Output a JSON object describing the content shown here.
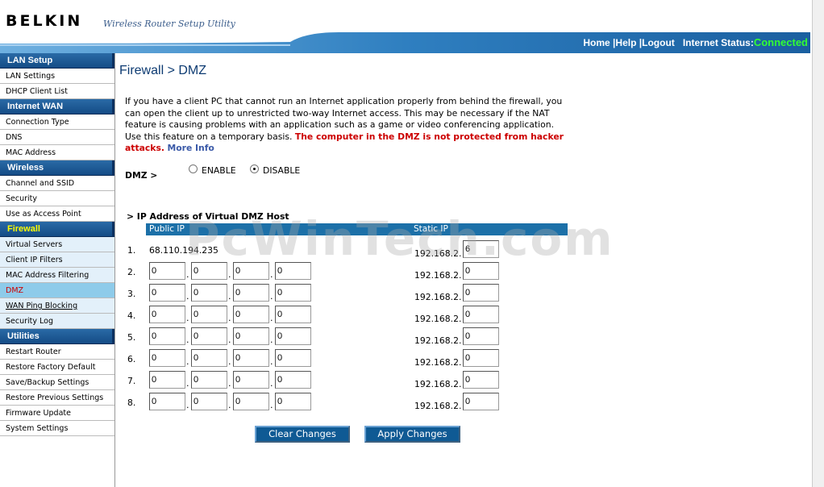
{
  "header": {
    "brand": "BELKIN",
    "tagline": "Wireless Router Setup Utility",
    "home": "Home",
    "help": "Help",
    "logout": "Logout",
    "status_label": "Internet Status:",
    "status_value": "Connected",
    "status_color": "#33ff33"
  },
  "sidebar": {
    "sections": [
      {
        "title": "LAN Setup",
        "items": [
          "LAN Settings",
          "DHCP Client List"
        ]
      },
      {
        "title": "Internet WAN",
        "items": [
          "Connection Type",
          "DNS",
          "MAC Address"
        ]
      },
      {
        "title": "Wireless",
        "items": [
          "Channel and SSID",
          "Security",
          "Use as Access Point"
        ]
      },
      {
        "title": "Firewall",
        "items": [
          "Virtual Servers",
          "Client IP Filters",
          "MAC Address Filtering",
          "DMZ",
          "WAN Ping Blocking",
          "Security Log"
        ]
      },
      {
        "title": "Utilities",
        "items": [
          "Restart Router",
          "Restore Factory Default",
          "Save/Backup Settings",
          "Restore Previous Settings",
          "Firmware Update",
          "System Settings"
        ]
      }
    ]
  },
  "main": {
    "title": "Firewall > DMZ",
    "description": "If you have a client PC that cannot run an Internet application properly from behind the firewall, you can open the client up to unrestricted two-way Internet access. This may be necessary if the NAT feature is causing problems with an application such as a game or video conferencing application. Use this feature on a temporary basis.",
    "warning": "The computer in the DMZ is not protected from hacker attacks.",
    "more_info": "More Info",
    "dmz_label": "DMZ >",
    "enable_label": "ENABLE",
    "disable_label": "DISABLE",
    "selected": "DISABLE",
    "subheading": "> IP Address of Virtual DMZ Host",
    "col_public": "Public IP",
    "col_static": "Static IP",
    "row1": {
      "num": "1.",
      "public_ip": "68.110.194.235",
      "static_prefix": "192.168.2.",
      "static_last": "6"
    },
    "rows": [
      {
        "num": "2.",
        "octets": [
          "0",
          "0",
          "0",
          "0"
        ],
        "static_prefix": "192.168.2.",
        "static_last": "0"
      },
      {
        "num": "3.",
        "octets": [
          "0",
          "0",
          "0",
          "0"
        ],
        "static_prefix": "192.168.2.",
        "static_last": "0"
      },
      {
        "num": "4.",
        "octets": [
          "0",
          "0",
          "0",
          "0"
        ],
        "static_prefix": "192.168.2.",
        "static_last": "0"
      },
      {
        "num": "5.",
        "octets": [
          "0",
          "0",
          "0",
          "0"
        ],
        "static_prefix": "192.168.2.",
        "static_last": "0"
      },
      {
        "num": "6.",
        "octets": [
          "0",
          "0",
          "0",
          "0"
        ],
        "static_prefix": "192.168.2.",
        "static_last": "0"
      },
      {
        "num": "7.",
        "octets": [
          "0",
          "0",
          "0",
          "0"
        ],
        "static_prefix": "192.168.2.",
        "static_last": "0"
      },
      {
        "num": "8.",
        "octets": [
          "0",
          "0",
          "0",
          "0"
        ],
        "static_prefix": "192.168.2.",
        "static_last": "0"
      }
    ],
    "clear_button": "Clear Changes",
    "apply_button": "Apply Changes"
  },
  "watermark": "PcWinTech.com"
}
